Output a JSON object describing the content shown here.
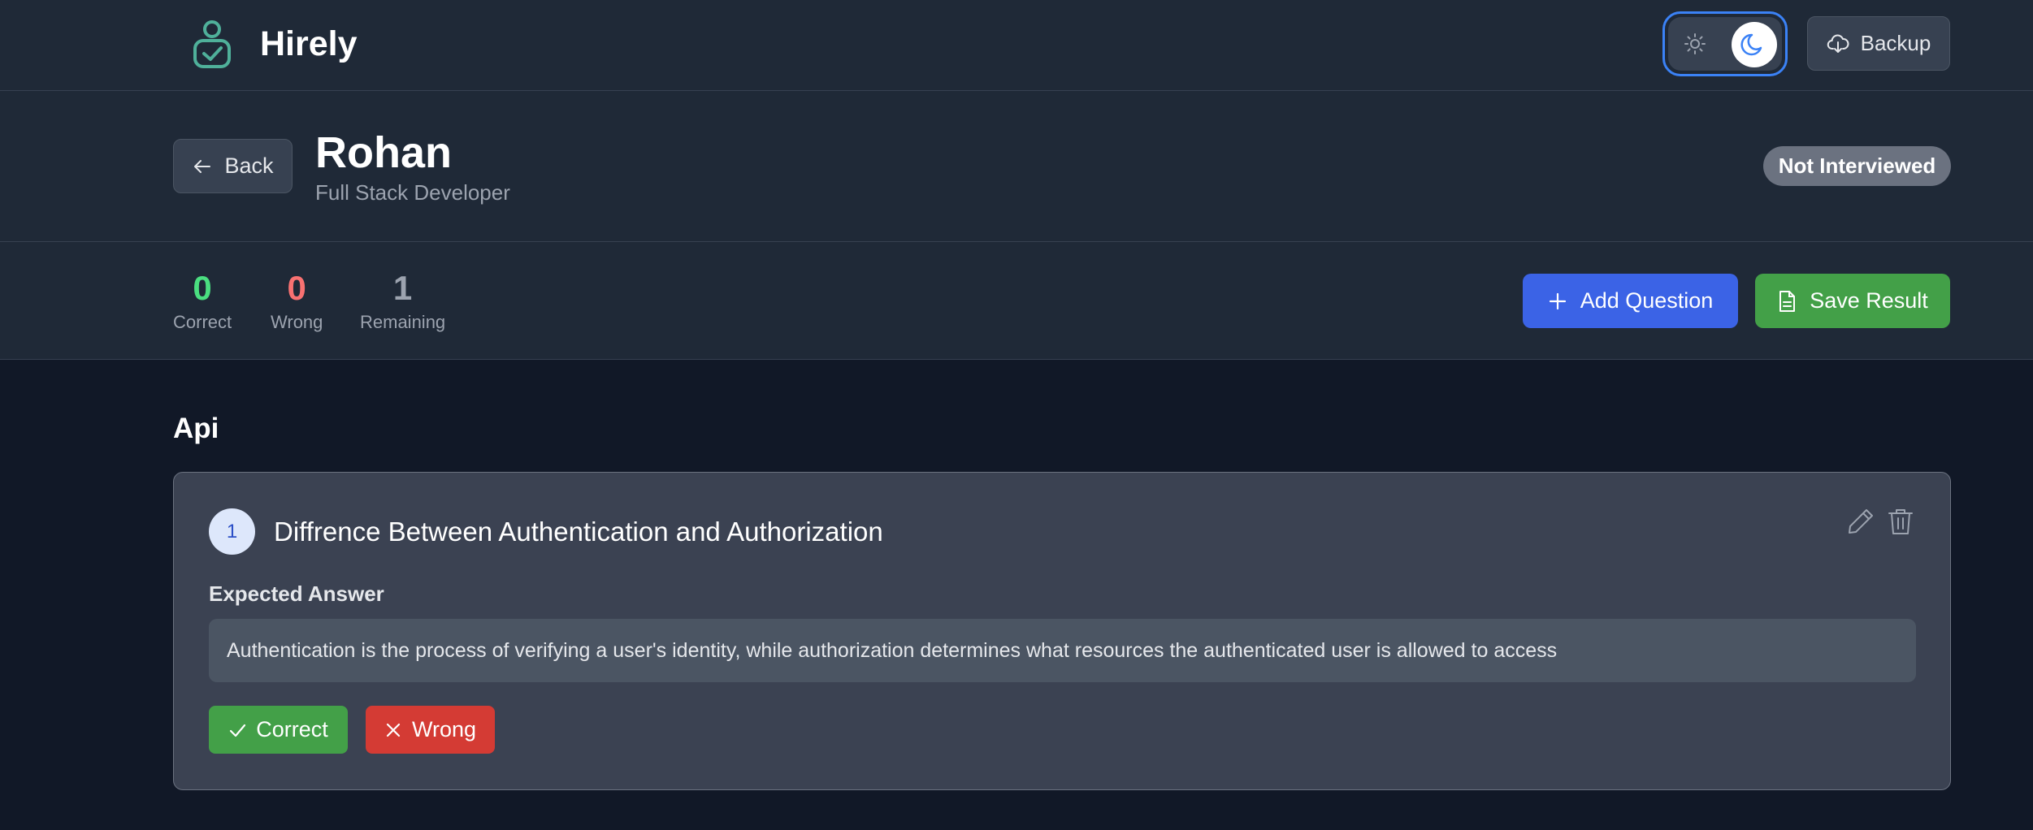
{
  "app": {
    "name": "Hirely"
  },
  "topbar": {
    "backup_label": "Backup",
    "theme": "dark"
  },
  "candidate": {
    "back_label": "Back",
    "name": "Rohan",
    "role": "Full Stack Developer",
    "status": "Not Interviewed"
  },
  "stats": [
    {
      "value": "0",
      "label": "Correct",
      "color": "#4ade80"
    },
    {
      "value": "0",
      "label": "Wrong",
      "color": "#f87171"
    },
    {
      "value": "1",
      "label": "Remaining",
      "color": "#9ca3af"
    }
  ],
  "actions": {
    "add_question": "Add Question",
    "save_result": "Save Result"
  },
  "section": {
    "title": "Api",
    "questions": [
      {
        "number": "1",
        "text": "Diffrence Between Authentication and Authorization",
        "expected_label": "Expected Answer",
        "expected_answer": "Authentication is the process of verifying a user's identity, while authorization determines what resources the authenticated user is allowed to access",
        "correct_label": "Correct",
        "wrong_label": "Wrong"
      }
    ]
  },
  "colors": {
    "accent": "#3b63e6",
    "success": "#43a048",
    "danger": "#d43b34",
    "logo": "#4fb09a"
  }
}
